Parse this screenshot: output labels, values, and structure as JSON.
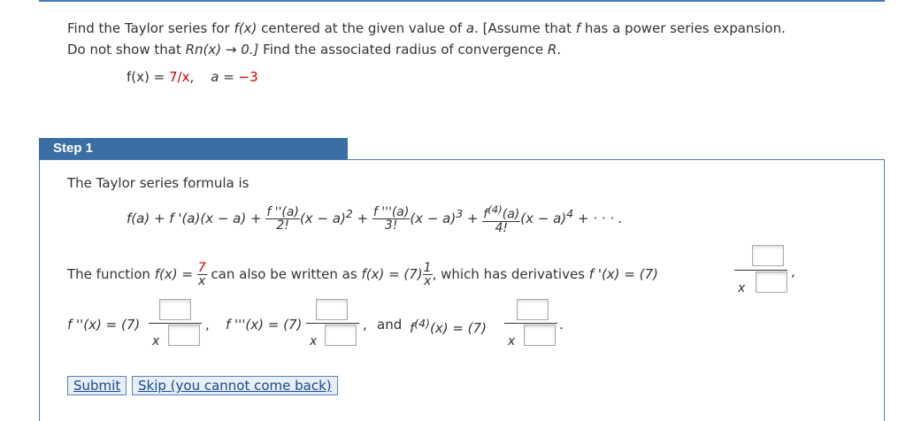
{
  "problem": {
    "line1_part1": "Find the Taylor series for",
    "line1_fx": "f(x)",
    "line1_part2": "centered at the given value of",
    "line1_a": "a",
    "line1_part3": ". [Assume that",
    "line1_f": "f",
    "line1_part4": "has a power series expansion.",
    "line2_part1": "Do not show that",
    "line2_rn": "Rn(x) → 0.]",
    "line2_part2": "Find the associated radius of convergence",
    "line2_R": "R",
    "func_lhs": "f(x) = ",
    "func_rhs": "7/x",
    "a_lhs": "a = ",
    "a_value": "−3"
  },
  "step": {
    "title": "Step 1",
    "formula_intro": "The Taylor series formula is",
    "formula": {
      "t1": "f(a) + f '(a)(x − a) + ",
      "f2_num": "f ''(a)",
      "f2_den": "2!",
      "t2": "(x − a)",
      "t2_exp": "2",
      "plus": " + ",
      "f3_num": "f '''(a)",
      "f3_den": "3!",
      "t3": "(x − a)",
      "t3_exp": "3",
      "f4_num": "f",
      "f4_sup": "(4)",
      "f4_num_tail": "(a)",
      "f4_den": "4!",
      "t4": "(x − a)",
      "t4_exp": "4",
      "tail": " + · · · ."
    },
    "rewrite": {
      "part1": "The function",
      "fx": "f(x) =",
      "frac_num": "7",
      "frac_den": "x",
      "part2": "can also be written as",
      "fx2": "f(x) = (7)",
      "frac2_num": "1",
      "frac2_den": "x",
      "part3": ", which has derivatives",
      "fprime": "f '(x) = (7)",
      "den_x": "x",
      "comma": ","
    },
    "derivs": {
      "f2": "f ''(x) = (7)",
      "f3": "f '''(x) = (7)",
      "and": "and",
      "f4": "f",
      "f4_sup": "(4)",
      "f4_tail": "(x) = (7)",
      "den_x": "x",
      "comma": ",",
      "period": "."
    }
  },
  "buttons": {
    "submit": "Submit",
    "skip": "Skip (you cannot come back)"
  },
  "colors": {
    "accent": "#3a6ea5",
    "highlight_red": "#cc0000"
  }
}
